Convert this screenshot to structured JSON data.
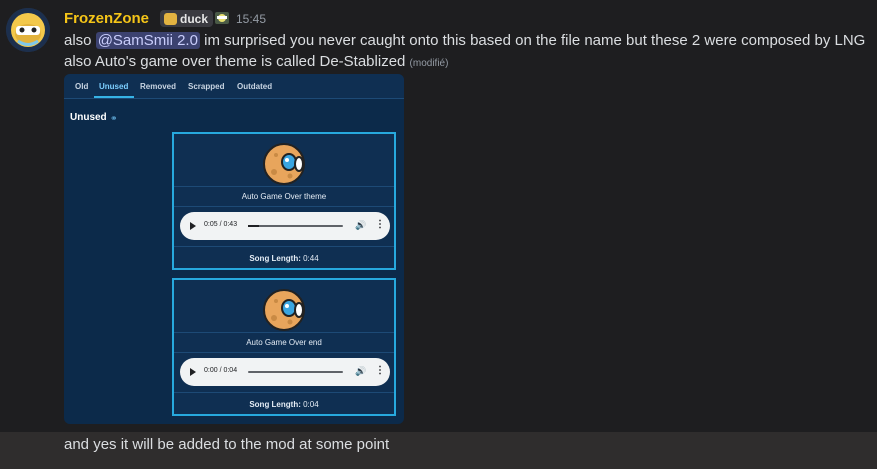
{
  "message": {
    "username": "FrozenZone",
    "tag": "duck",
    "time": "15:45",
    "line1_prefix": "also ",
    "mention": "@SamSmii 2.0",
    "line1_suffix": " im surprised you never caught onto this based on the file name but these 2 were composed by LNG",
    "line2": "also Auto's game over theme is called De-Stablized",
    "edited": "(modifié)",
    "followup": "and yes it will be added to the mod at some point"
  },
  "embed": {
    "tabs": [
      "Old",
      "Unused",
      "Removed",
      "Scrapped",
      "Outdated"
    ],
    "active_tab": "Unused",
    "section_title": "Unused",
    "cards": [
      {
        "title": "Auto Game Over theme",
        "time_display": "0:05 / 0:43",
        "progress": 0.12,
        "length_label": "Song Length:",
        "length_value": " 0:44"
      },
      {
        "title": "Auto Game Over end",
        "time_display": "0:00 / 0:04",
        "progress": 0.0,
        "length_label": "Song Length:",
        "length_value": " 0:04"
      }
    ]
  },
  "colors": {
    "username": "#f5c518",
    "mention_bg": "#3c4270",
    "embed_bg": "#0c2a4a",
    "card_border": "#27a9de"
  },
  "icons": {
    "play": "play-icon",
    "volume": "volume-icon",
    "more": "more-options-icon",
    "link": "link-icon"
  }
}
